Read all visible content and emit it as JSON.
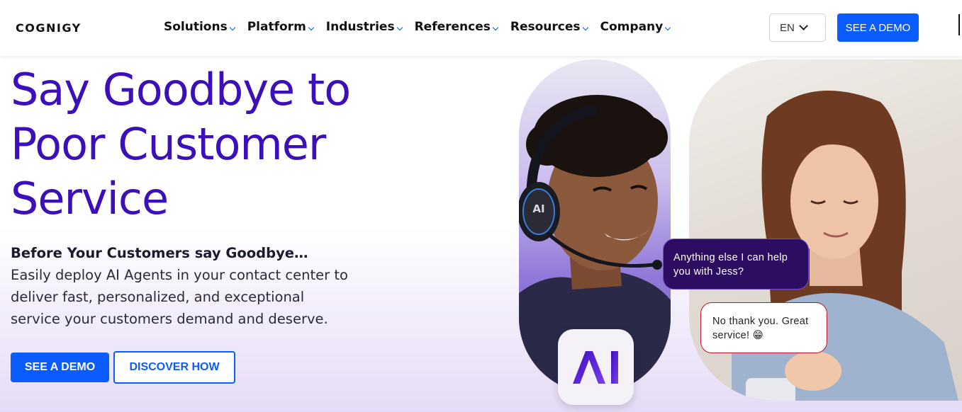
{
  "header": {
    "logo": "COGNIGY",
    "nav": [
      "Solutions",
      "Platform",
      "Industries",
      "References",
      "Resources",
      "Company"
    ],
    "lang": "EN",
    "cta": "SEE A DEMO"
  },
  "hero": {
    "headline_1": "Say Goodbye to",
    "headline_2": "Poor Customer",
    "headline_3": "Service",
    "sub_bold": "Before Your Customers say Goodbye…",
    "sub_rest": " Easily deploy AI Agents in your contact center to deliver fast, personalized, and exceptional service your customers demand and deserve.",
    "primary_button": "SEE A DEMO",
    "secondary_button": "DISCOVER HOW"
  },
  "visual": {
    "ai_badge": "AI",
    "headset_badge": "AI",
    "bubble_agent": "Anything else I can help you with Jess?",
    "bubble_customer": "No thank you. Great service! 😁",
    "colors": {
      "brand_purple": "#3b10b8",
      "brand_blue": "#0a5cff",
      "bubble_dark": "#2d0d62",
      "bubble_border_red": "#c0142b"
    }
  }
}
